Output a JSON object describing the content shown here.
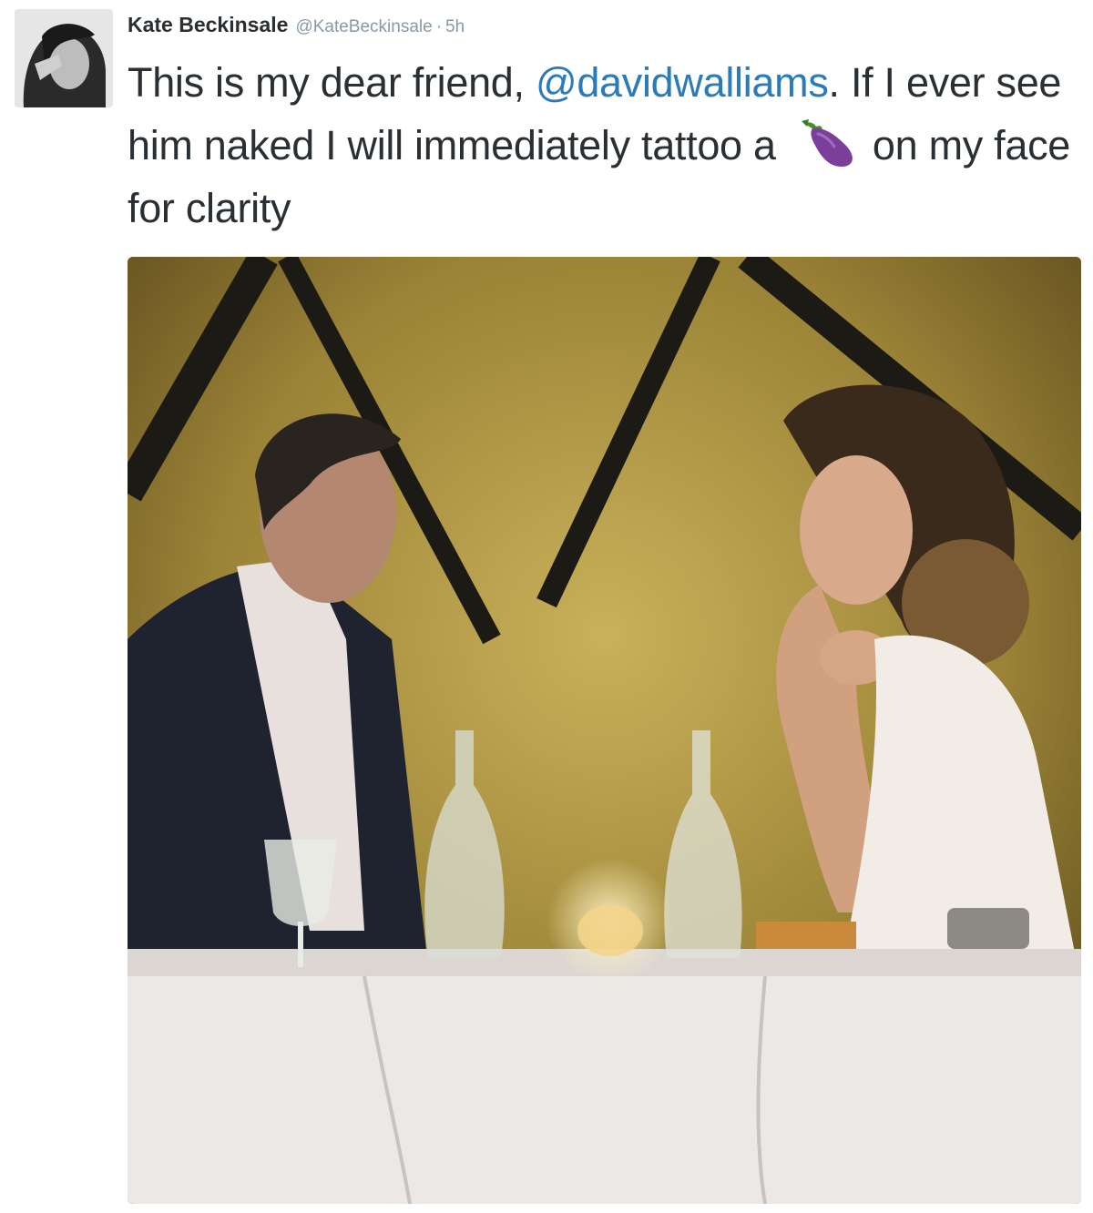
{
  "tweet": {
    "author": {
      "display_name": "Kate Beckinsale",
      "handle": "@KateBeckinsale",
      "separator": "·",
      "time": "5h",
      "avatar_icon": "avatar-photo"
    },
    "text": {
      "part1": "This is my dear friend, ",
      "mention": "@davidwalliams",
      "part2": ". If I ever see him naked I will immediately tattoo a",
      "emoji_icon": "eggplant-emoji-icon",
      "part3": "on my face for clarity"
    },
    "media": {
      "type": "photo"
    }
  },
  "colors": {
    "text": "#292f33",
    "muted": "#8899a6",
    "link": "#2b7bb9",
    "emoji": "#7b3f9a"
  }
}
